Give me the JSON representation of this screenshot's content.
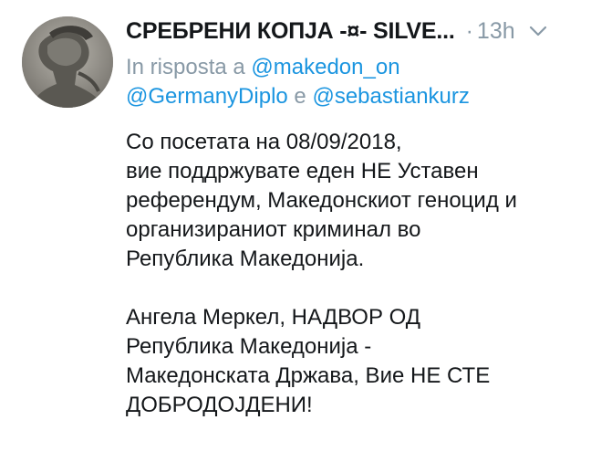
{
  "tweet": {
    "display_name": "СРЕБРЕНИ КОПЈА -¤- SILVE...",
    "time_separator": "·",
    "timestamp": "13h",
    "reply_prefix": "In risposta a",
    "mention_1": "@makedon_on",
    "mention_2": "@GermanyDiplo",
    "reply_conjunction": "e",
    "mention_3": "@sebastiankurz",
    "paragraph_1": [
      "Со посетата на 08/09/2018,",
      "вие поддржувате еден НЕ Уставен",
      "референдум, Македонскиот геноцид и",
      "организираниот криминал во",
      "Република Македонија."
    ],
    "paragraph_2": [
      "Ангела Меркел, НАДВОР ОД",
      "Република Македонија -",
      "Македонската Држава, Вие НЕ СТЕ",
      "ДОБРОДОЈДЕНИ!"
    ]
  },
  "icons": {
    "avatar": "profile-avatar",
    "caret": "chevron-down-icon"
  },
  "colors": {
    "text": "#14171a",
    "muted": "#8899a6",
    "link": "#1b95e0"
  }
}
